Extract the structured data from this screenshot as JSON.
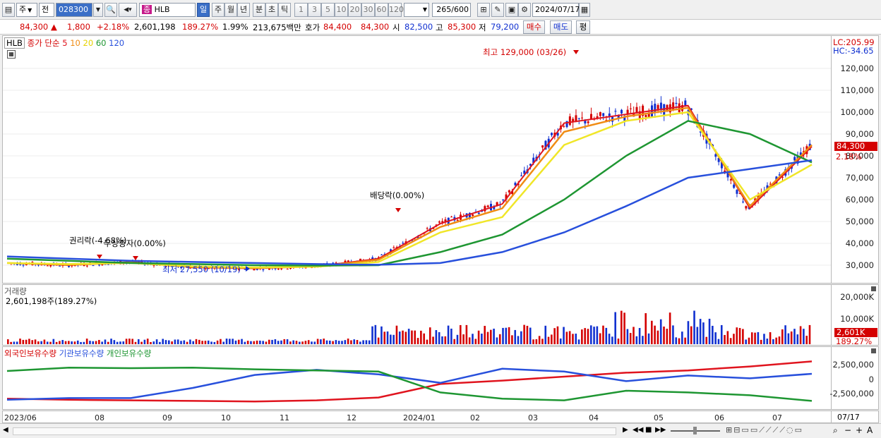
{
  "toolbar": {
    "market": "주",
    "prev": "전",
    "code": "028300",
    "type": "종",
    "name": "HLB",
    "periods": [
      "일",
      "주",
      "월",
      "년",
      "분",
      "초",
      "틱"
    ],
    "intervals": [
      "1",
      "3",
      "5",
      "10",
      "20",
      "30",
      "60",
      "120"
    ],
    "count": "265",
    "count_max": "/600",
    "date": "2024/07/17"
  },
  "quote": {
    "price": "84,300",
    "change_arrow": "▲",
    "change": "1,800",
    "change_pct": "+2.18%",
    "volume": "2,601,198",
    "volume_ratio": "189.27%",
    "turnover": "1.99%",
    "amount": "213,675백만",
    "ask_label": "호가",
    "ask": "84,400",
    "bid": "84,300",
    "open_label": "시",
    "open": "82,500",
    "high_label": "고",
    "high": "85,300",
    "low_label": "저",
    "low": "79,200",
    "buy": "매수",
    "sell": "매도",
    "avg": "평"
  },
  "price_pane": {
    "symbol": "HLB",
    "legend_title": "종가 단순",
    "ma_labels": [
      "5",
      "10",
      "20",
      "60",
      "120"
    ],
    "lc": "LC:205.99",
    "hc": "HC:-34.65",
    "y_ticks": [
      "120,000",
      "110,000",
      "100,000",
      "90,000",
      "80,000",
      "70,000",
      "60,000",
      "50,000",
      "40,000",
      "30,000"
    ],
    "cur_price_tag": "84,300",
    "cur_pct_tag": "2.18%",
    "annotations": {
      "high": "최고 129,000 (03/26)",
      "low": "최저 27,550 (10/19)",
      "dividend": "배당락(0.00%)",
      "rights": "권리락(-4.68%)",
      "bonus": "무상증자(0.00%)"
    }
  },
  "volume_pane": {
    "title": "거래량",
    "value": "2,601,198주(189.27%)",
    "y_ticks": [
      "20,000K",
      "10,000K"
    ],
    "cur_tag": "2,601K",
    "cur_pct": "189.27%"
  },
  "holder_pane": {
    "titles": [
      "외국인보유수량",
      "기관보유수량",
      "개인보유수량"
    ],
    "y_ticks": [
      "2,500,000",
      "0",
      "-2,500,000"
    ]
  },
  "x_axis": {
    "labels": [
      "2023/06",
      "08",
      "09",
      "10",
      "11",
      "12",
      "2024/01",
      "02",
      "03",
      "04",
      "05",
      "06",
      "07"
    ],
    "end_label": "07/17"
  },
  "colors": {
    "ma5": "#e0141e",
    "ma10": "#f08c14",
    "ma20": "#f0e628",
    "ma60": "#1e9632",
    "ma120": "#2850dc",
    "up": "#d40000",
    "down": "#1030d0"
  },
  "chart_data": {
    "type": "line",
    "title": "HLB",
    "xlabel": "",
    "ylabel": "",
    "ylim": [
      24000,
      132000
    ],
    "x": [
      "2023/06",
      "2023/07",
      "2023/08",
      "2023/09",
      "2023/10",
      "2023/11",
      "2023/12",
      "2024/01",
      "2024/02",
      "2024/03",
      "2024/04",
      "2024/05",
      "2024/06",
      "2024/07"
    ],
    "series": [
      {
        "name": "5",
        "values": [
          31000,
          30000,
          31500,
          29000,
          28500,
          29500,
          33000,
          49000,
          58000,
          95000,
          99000,
          103000,
          56000,
          84300
        ]
      },
      {
        "name": "10",
        "values": [
          31000,
          30200,
          31200,
          29200,
          28700,
          29400,
          32500,
          47500,
          56000,
          91000,
          98000,
          102000,
          57000,
          85000
        ]
      },
      {
        "name": "20",
        "values": [
          31000,
          30500,
          31000,
          29500,
          29000,
          29300,
          31500,
          45000,
          52000,
          85000,
          96000,
          100000,
          60000,
          76000
        ]
      },
      {
        "name": "60",
        "values": [
          33000,
          32000,
          31000,
          30500,
          30000,
          29800,
          30000,
          36000,
          44000,
          60000,
          80000,
          96000,
          90000,
          77000
        ]
      },
      {
        "name": "120",
        "values": [
          34000,
          33000,
          32000,
          31500,
          31000,
          30500,
          30200,
          31000,
          36000,
          45000,
          57000,
          70000,
          74000,
          78000
        ]
      }
    ]
  }
}
